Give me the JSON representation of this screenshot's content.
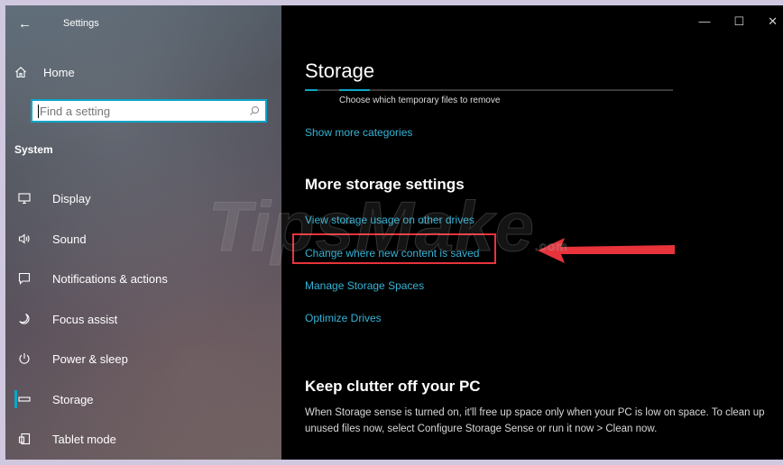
{
  "window": {
    "title": "Settings",
    "controls": [
      "—",
      "☐",
      "✕"
    ]
  },
  "sidebar": {
    "home_label": "Home",
    "search_placeholder": "Find a setting",
    "section_title": "System",
    "items": [
      {
        "label": "Display",
        "icon": "display-icon"
      },
      {
        "label": "Sound",
        "icon": "sound-icon"
      },
      {
        "label": "Notifications & actions",
        "icon": "notifications-icon"
      },
      {
        "label": "Focus assist",
        "icon": "focus-assist-icon"
      },
      {
        "label": "Power & sleep",
        "icon": "power-icon"
      },
      {
        "label": "Storage",
        "icon": "storage-icon",
        "active": true
      },
      {
        "label": "Tablet mode",
        "icon": "tablet-mode-icon"
      }
    ]
  },
  "main": {
    "title": "Storage",
    "temp_files_caption": "Choose which temporary files to remove",
    "show_more_link": "Show more categories",
    "more_storage_heading": "More storage settings",
    "links": [
      "View storage usage on other drives",
      "Change where new content is saved",
      "Manage Storage Spaces",
      "Optimize Drives"
    ],
    "keep_clutter_heading": "Keep clutter off your PC",
    "keep_clutter_description": "When Storage sense is turned on, it'll free up space only when your PC is low on space. To clean up unused files now, select Configure Storage Sense or run it now > Clean now."
  },
  "annotation": {
    "highlighted_link_index": 1,
    "color": "#e8333b"
  },
  "watermark": {
    "text": "TipsMake",
    "suffix": ".com"
  },
  "colors": {
    "accent": "#0ca6c8",
    "link": "#34b4d6",
    "content_bg": "#000000"
  }
}
